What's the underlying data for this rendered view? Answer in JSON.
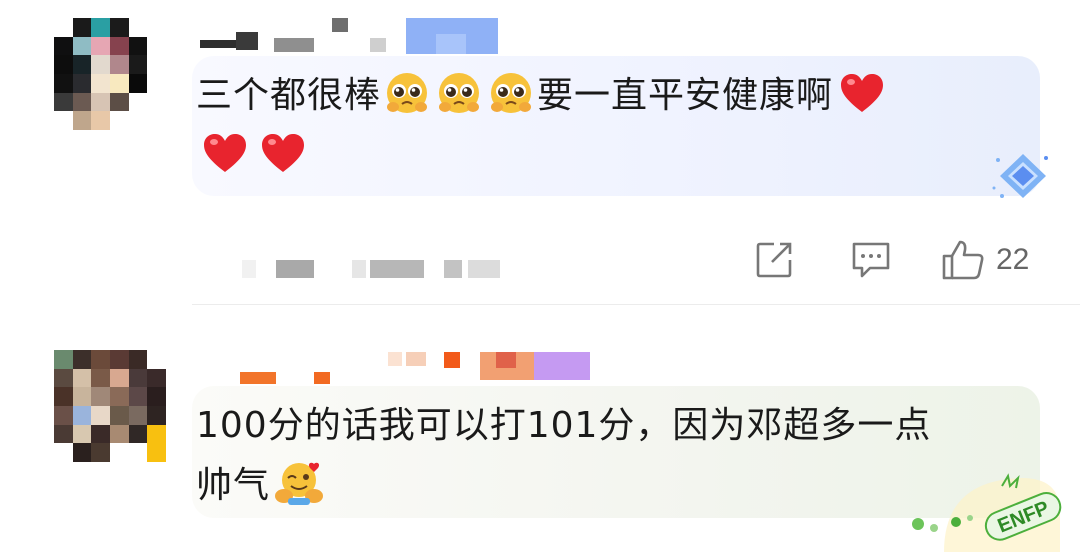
{
  "comments": [
    {
      "text_parts": [
        "三个都很棒",
        "要一直平安健康啊"
      ],
      "emojis": [
        "pleading-face-emoji",
        "pleading-face-emoji",
        "pleading-face-emoji"
      ],
      "hearts": [
        "red-heart-emoji",
        "red-heart-emoji",
        "red-heart-emoji"
      ],
      "like_count": "22",
      "actions": [
        "share-icon",
        "comment-icon",
        "thumbs-up-icon"
      ]
    },
    {
      "text_line1": "100分的话我可以打101分，因为邓超多一点",
      "text_line2": "帅气",
      "emoji": "hugging-face-emoji",
      "badge_text": "ENFP"
    }
  ],
  "colors": {
    "bubble1_accent": "#e8eefc",
    "bubble2_accent": "#edf3e8",
    "heart": "#e8242e",
    "emoji_yellow": "#f7c23a",
    "badge_blue": "#5b8ef0",
    "badge_green": "#4caf3c"
  }
}
